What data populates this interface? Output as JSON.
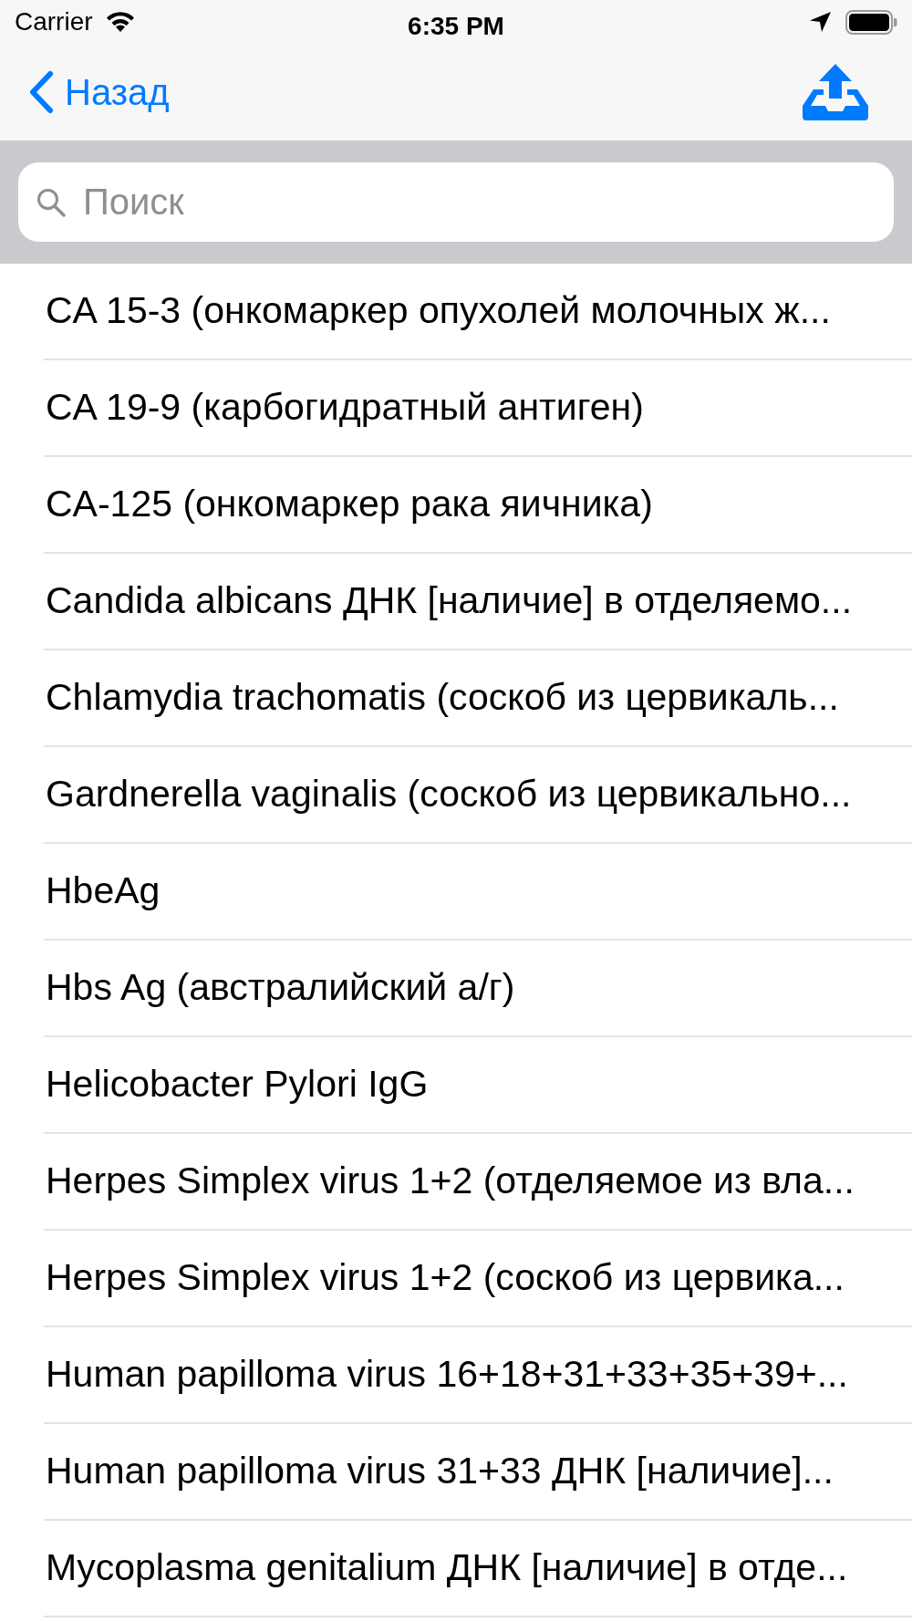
{
  "status_bar": {
    "carrier": "Carrier",
    "time": "6:35 PM"
  },
  "nav_bar": {
    "back_label": "Назад"
  },
  "search": {
    "placeholder": "Поиск"
  },
  "items": [
    {
      "label": "CA 15-3 (онкомаркер опухолей молочных ж..."
    },
    {
      "label": "CA 19-9 (карбогидратный антиген)"
    },
    {
      "label": "CA-125 (онкомаркер рака яичника)"
    },
    {
      "label": "Candida albicans ДНК [наличие] в отделяемо..."
    },
    {
      "label": "Chlamydia trachomatis (соскоб из цервикаль..."
    },
    {
      "label": "Gardnerella vaginalis (соскоб из цервикально..."
    },
    {
      "label": "HbeAg"
    },
    {
      "label": "Hbs Ag (австралийский а/г)"
    },
    {
      "label": "Helicobacter Pylori IgG"
    },
    {
      "label": "Herpes Simplex virus 1+2 (отделяемое из вла..."
    },
    {
      "label": "Herpes Simplex virus 1+2 (соскоб из цервика..."
    },
    {
      "label": "Human papilloma virus 16+18+31+33+35+39+..."
    },
    {
      "label": "Human papilloma virus 31+33 ДНК [наличие]..."
    },
    {
      "label": "Mycoplasma genitalium ДНК [наличие] в отде..."
    }
  ]
}
